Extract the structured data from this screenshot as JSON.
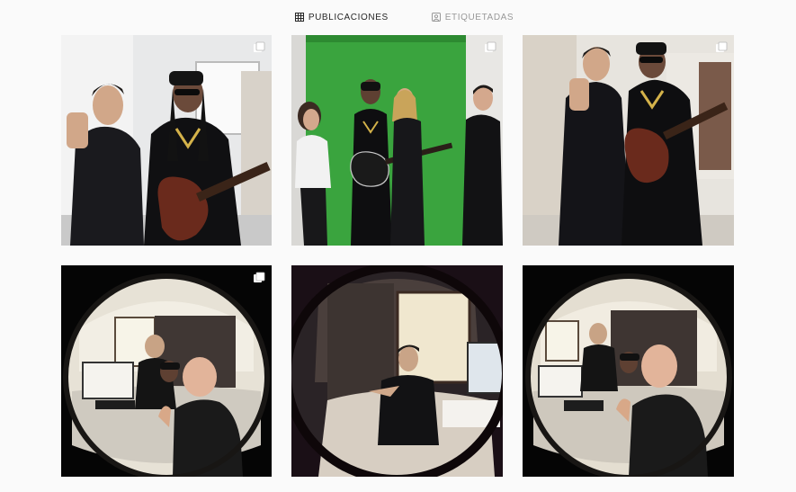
{
  "tabs": [
    {
      "label": "PUBLICACIONES",
      "icon": "grid-icon",
      "active": true
    },
    {
      "label": "ETIQUETADAS",
      "icon": "tagged-icon",
      "active": false
    }
  ],
  "posts": [
    {
      "icon": "multiple-photos-icon",
      "has_multiple": true
    },
    {
      "icon": "multiple-photos-icon",
      "has_multiple": true
    },
    {
      "icon": "multiple-photos-icon",
      "has_multiple": true
    },
    {
      "icon": "multiple-photos-icon",
      "has_multiple": true
    },
    {
      "has_multiple": false
    },
    {
      "has_multiple": false
    }
  ],
  "colors": {
    "active_tab": "#262626",
    "inactive_tab": "#999999",
    "background": "#fafafa"
  }
}
